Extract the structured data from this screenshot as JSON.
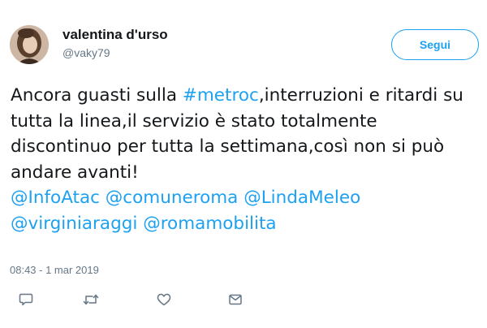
{
  "user": {
    "display_name": "valentina d'urso",
    "handle": "@vaky79"
  },
  "follow_label": "Segui",
  "tweet": {
    "text_before_hashtag": "Ancora guasti sulla ",
    "hashtag": "#metroc",
    "text_after_hashtag": ",interruzioni e ritardi su tutta la linea,il servizio è stato totalmente discontinuo per tutta la settimana,così non si può andare avanti!",
    "mentions": [
      "@InfoAtac",
      "@comuneroma",
      "@LindaMeleo",
      "@virginiaraggi",
      "@romamobilita"
    ]
  },
  "timestamp": "08:43 - 1 mar 2019",
  "actions": [
    {
      "name": "reply",
      "icon": "speech-bubble-icon"
    },
    {
      "name": "retweet",
      "icon": "retweet-icon"
    },
    {
      "name": "like",
      "icon": "heart-icon"
    },
    {
      "name": "direct-message",
      "icon": "envelope-icon"
    }
  ],
  "colors": {
    "accent": "#1da1f2",
    "text": "#14171a",
    "secondary_text": "#657786"
  }
}
